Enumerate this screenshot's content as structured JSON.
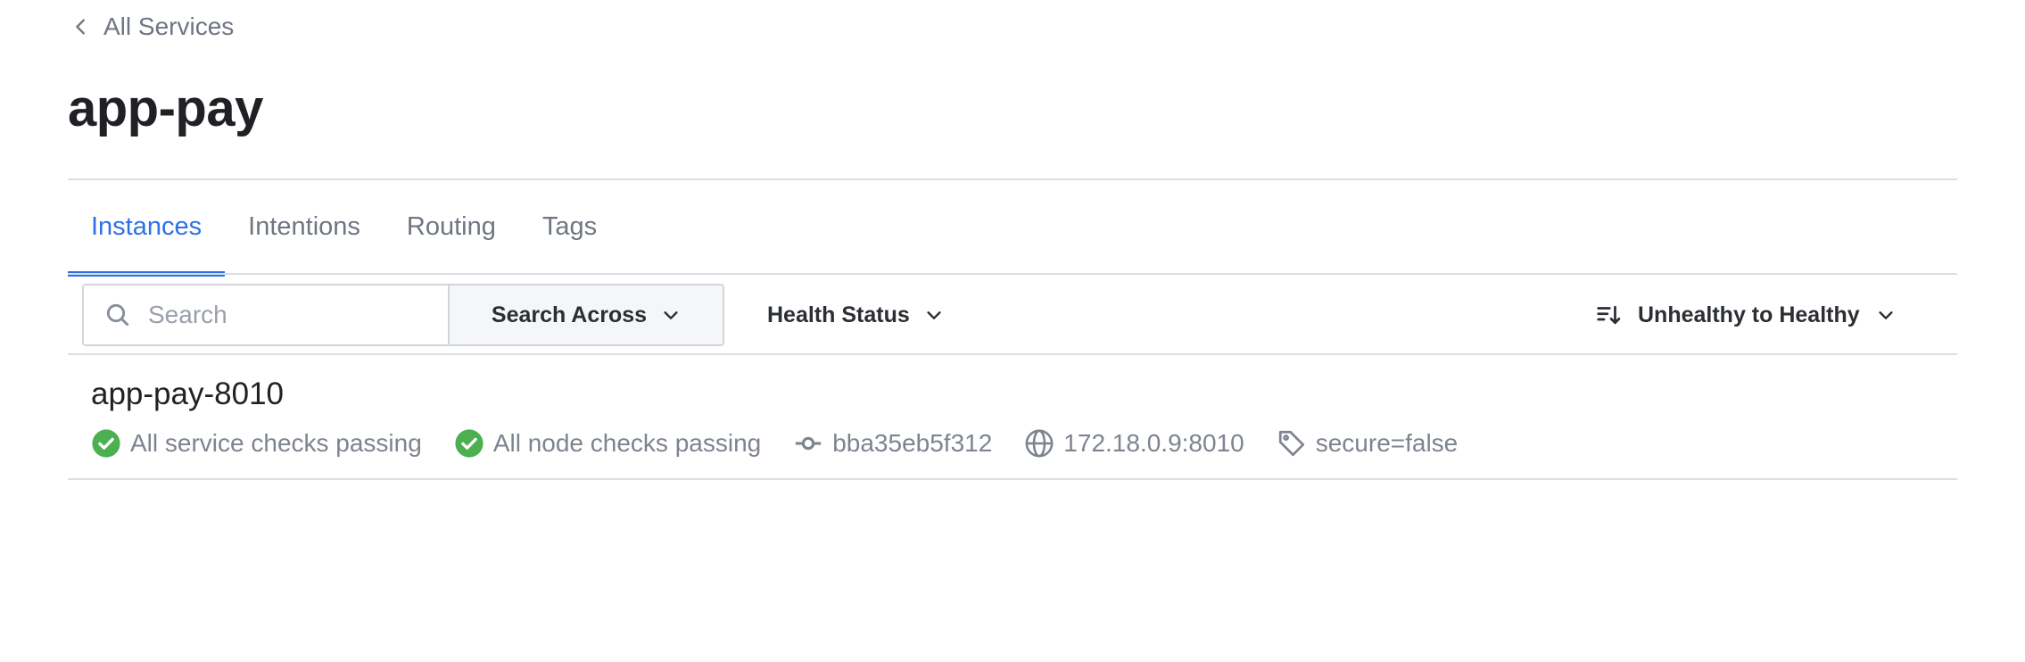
{
  "breadcrumb": {
    "label": "All Services"
  },
  "page": {
    "title": "app-pay"
  },
  "tabs": [
    {
      "label": "Instances",
      "active": true
    },
    {
      "label": "Intentions",
      "active": false
    },
    {
      "label": "Routing",
      "active": false
    },
    {
      "label": "Tags",
      "active": false
    }
  ],
  "toolbar": {
    "search_placeholder": "Search",
    "search_value": "",
    "search_across_label": "Search Across",
    "health_status_label": "Health Status",
    "sort_label": "Unhealthy to Healthy"
  },
  "instances": [
    {
      "name": "app-pay-8010",
      "service_checks": "All service checks passing",
      "node_checks": "All node checks passing",
      "node": "bba35eb5f312",
      "address": "172.18.0.9:8010",
      "tag": "secure=false"
    }
  ],
  "colors": {
    "accent": "#2e71e5",
    "success": "#4caf50",
    "muted_text": "#7d848f",
    "border": "#dcdee3"
  },
  "icons": {
    "back": "chevron-left-icon",
    "search": "search-icon",
    "dropdown": "chevron-down-icon",
    "sort": "sort-icon",
    "passing": "check-circle-icon",
    "node": "git-commit-icon",
    "address": "globe-icon",
    "tag": "tag-icon"
  }
}
